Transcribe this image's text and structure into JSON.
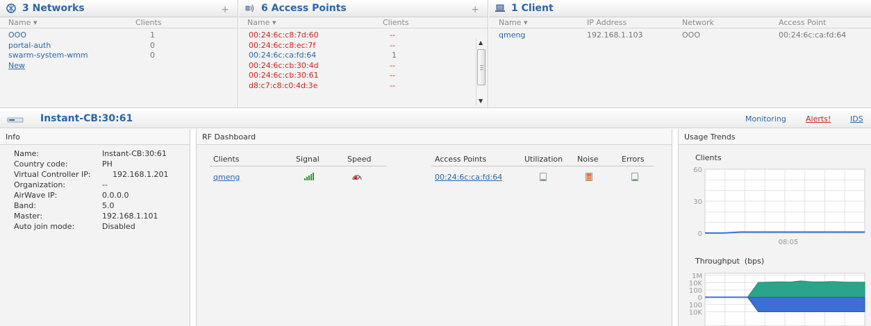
{
  "networks": {
    "title": "3 Networks",
    "add": "+",
    "col_name": "Name",
    "col_clients": "Clients",
    "rows": [
      {
        "name": "OOO",
        "clients": "1"
      },
      {
        "name": "portal-auth",
        "clients": "0"
      },
      {
        "name": "swarm-system-wmm",
        "clients": "0"
      }
    ],
    "new_link": "New"
  },
  "access_points": {
    "title": "6 Access Points",
    "add": "+",
    "col_name": "Name",
    "col_clients": "Clients",
    "rows": [
      {
        "name": "00:24:6c:c8:7d:60",
        "clients": "--",
        "status": "down"
      },
      {
        "name": "00:24:6c:c8:ec:7f",
        "clients": "--",
        "status": "down"
      },
      {
        "name": "00:24:6c:ca:fd:64",
        "clients": "1",
        "status": "up"
      },
      {
        "name": "00:24:6c:cb:30:4d",
        "clients": "--",
        "status": "down"
      },
      {
        "name": "00:24:6c:cb:30:61",
        "clients": "--",
        "status": "down"
      },
      {
        "name": "d8:c7:c8:c0:4d:3e",
        "clients": "--",
        "status": "down"
      }
    ]
  },
  "clients": {
    "title": "1 Client",
    "col_name": "Name",
    "col_ip": "IP Address",
    "col_network": "Network",
    "col_ap": "Access Point",
    "rows": [
      {
        "name": "qmeng",
        "ip": "192.168.1.103",
        "network": "OOO",
        "ap": "00:24:6c:ca:fd:64"
      }
    ]
  },
  "device_bar": {
    "title": "Instant-CB:30:61",
    "monitoring": "Monitoring",
    "alerts": "Alerts!",
    "ids": "IDS"
  },
  "info": {
    "title": "Info",
    "items": [
      {
        "label": "Name:",
        "value": "Instant-CB:30:61"
      },
      {
        "label": "Country code:",
        "value": "PH"
      },
      {
        "label": "Virtual Controller IP:",
        "value": "192.168.1.201"
      },
      {
        "label": "Organization:",
        "value": "--"
      },
      {
        "label": "AirWave IP:",
        "value": "0.0.0.0"
      },
      {
        "label": "Band:",
        "value": "5.0"
      },
      {
        "label": "Master:",
        "value": "192.168.1.101"
      },
      {
        "label": "Auto join mode:",
        "value": "Disabled"
      }
    ]
  },
  "rf": {
    "title": "RF Dashboard",
    "col_clients": "Clients",
    "col_signal": "Signal",
    "col_speed": "Speed",
    "col_aps": "Access Points",
    "col_util": "Utilization",
    "col_noise": "Noise",
    "col_errors": "Errors",
    "client": "qmeng",
    "ap": "00:24:6c:ca:fd:64",
    "signal_level": 5,
    "noise_level": 5
  },
  "usage": {
    "title": "Usage Trends",
    "clients_title": "Clients",
    "throughput_title": "Throughput",
    "throughput_unit": "(bps)",
    "time_label": "08:05"
  },
  "colors": {
    "link": "#2a66a8",
    "down": "#cc2222",
    "chart_green": "#2aa58a",
    "chart_blue": "#3b6fd4"
  },
  "chart_data": [
    {
      "type": "line",
      "title": "Clients",
      "x": [
        "",
        "08:05",
        ""
      ],
      "ylim": [
        0,
        60
      ],
      "yticks": [
        "60",
        "30",
        "0"
      ],
      "series": [
        {
          "values": [
            0,
            0,
            1,
            1,
            1,
            1,
            1,
            1,
            1,
            1
          ]
        }
      ]
    },
    {
      "type": "area",
      "title": "Throughput",
      "ylabel": "(bps)",
      "yticks": [
        "1M",
        "10K",
        "100",
        "0",
        "100",
        "10K"
      ],
      "series": [
        {
          "values": [
            0,
            0,
            0,
            0,
            0,
            12000,
            14000,
            16000,
            15000,
            30000,
            18000,
            16000,
            20000,
            15000,
            14000,
            13000
          ]
        },
        {
          "values": [
            0,
            0,
            0,
            0,
            0,
            -10000,
            -10000,
            -10000,
            -10000,
            -10000,
            -10000,
            -10000,
            -10000,
            -10000,
            -10000,
            -10000
          ]
        }
      ]
    }
  ]
}
